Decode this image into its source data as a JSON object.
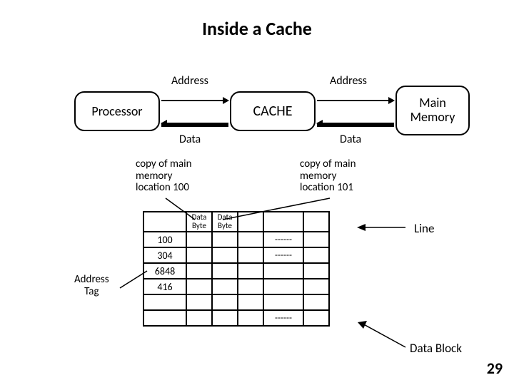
{
  "title": "Inside a Cache",
  "boxes": {
    "processor": "Processor",
    "cache": "CACHE",
    "memory_line1": "Main",
    "memory_line2": "Memory"
  },
  "bus": {
    "addr1": "Address",
    "addr2": "Address",
    "data1": "Data",
    "data2": "Data"
  },
  "annotations": {
    "copy100_line1": "copy of main",
    "copy100_line2": "memory",
    "copy100_line3": "location 100",
    "copy101_line1": "copy of main",
    "copy101_line2": "memory",
    "copy101_line3": "location 101",
    "address_tag_line1": "Address",
    "address_tag_line2": "Tag",
    "line_label": "Line",
    "block_label": "Data Block"
  },
  "table": {
    "headers": [
      "",
      "Data\nByte",
      "Data\nByte",
      "",
      "",
      ""
    ],
    "rows": [
      {
        "tag": "100",
        "cells": [
          "",
          "",
          "",
          "------",
          ""
        ]
      },
      {
        "tag": "304",
        "cells": [
          "",
          "",
          "",
          "------",
          ""
        ]
      },
      {
        "tag": "6848",
        "cells": [
          "",
          "",
          "",
          "",
          ""
        ]
      },
      {
        "tag": "416",
        "cells": [
          "",
          "",
          "",
          "",
          ""
        ]
      },
      {
        "tag": "",
        "cells": [
          "",
          "",
          "",
          "",
          ""
        ]
      },
      {
        "tag": "",
        "cells": [
          "",
          "",
          "",
          "------",
          ""
        ]
      }
    ],
    "last_cell_header": "Data\nByte",
    "last_cell_tag_header": ""
  },
  "page_number": "29"
}
